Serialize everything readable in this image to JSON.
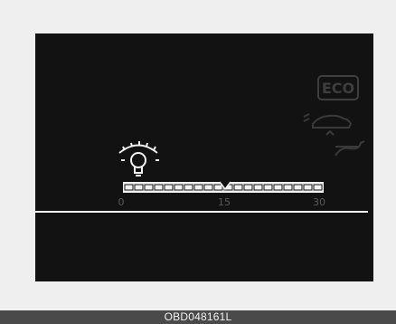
{
  "cluster": {
    "eco_label": "ECO",
    "scale": {
      "min_label": "0",
      "mid_label": "15",
      "max_label": "30"
    },
    "icons": [
      "eco-badge",
      "fuel-trip-icon",
      "car-slope-icon",
      "headlight-level-icon",
      "pointer-icon"
    ],
    "colors": {
      "background": "#121212",
      "foreground": "#f2f2f2",
      "dim": "#4a4a4a"
    }
  },
  "footer": {
    "code": "OBD048161L"
  }
}
